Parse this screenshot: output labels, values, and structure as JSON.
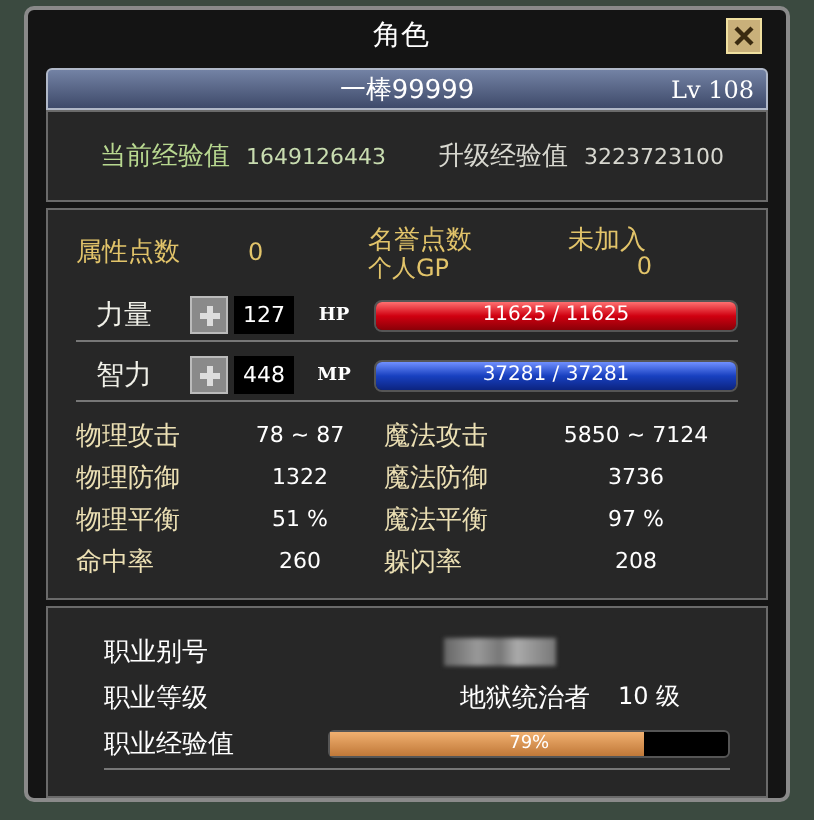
{
  "window": {
    "title": "角色"
  },
  "character": {
    "name": "一棒99999",
    "level": "Lv 108"
  },
  "experience": [
    {
      "kind": "current",
      "label": "当前经验值",
      "value": "1649126443"
    },
    {
      "kind": "next",
      "label": "升级经验值",
      "value": "3223723100"
    }
  ],
  "points": {
    "label": "属性点数",
    "value": "0",
    "honor_label": "名誉点数",
    "honor_value": "未加入",
    "gp_label": "个人GP",
    "gp_value": "0"
  },
  "attributes": [
    {
      "kind": "hp",
      "name": "力量",
      "value": "127",
      "bar_label": "HP",
      "reading": "11625 / 11625",
      "level": 1
    },
    {
      "kind": "mp",
      "name": "智力",
      "value": "448",
      "bar_label": "MP",
      "reading": "37281 / 37281",
      "level": 1
    }
  ],
  "stats": [
    {
      "label": "物理攻击",
      "value": "78 ~ 87"
    },
    {
      "label": "魔法攻击",
      "value": "5850 ~ 7124"
    },
    {
      "label": "物理防御",
      "value": "1322"
    },
    {
      "label": "魔法防御",
      "value": "3736"
    },
    {
      "label": "物理平衡",
      "value": "51 %"
    },
    {
      "label": "魔法平衡",
      "value": "97 %"
    },
    {
      "label": "命中率",
      "value": "260"
    },
    {
      "label": "躲闪率",
      "value": "208"
    }
  ],
  "job": {
    "alias_label": "职业别号",
    "level_label": "职业等级",
    "class_name": "地狱统治者",
    "job_level": "10 级",
    "exp_label": "职业经验值",
    "level": 0.79,
    "exp_reading": "79%"
  }
}
